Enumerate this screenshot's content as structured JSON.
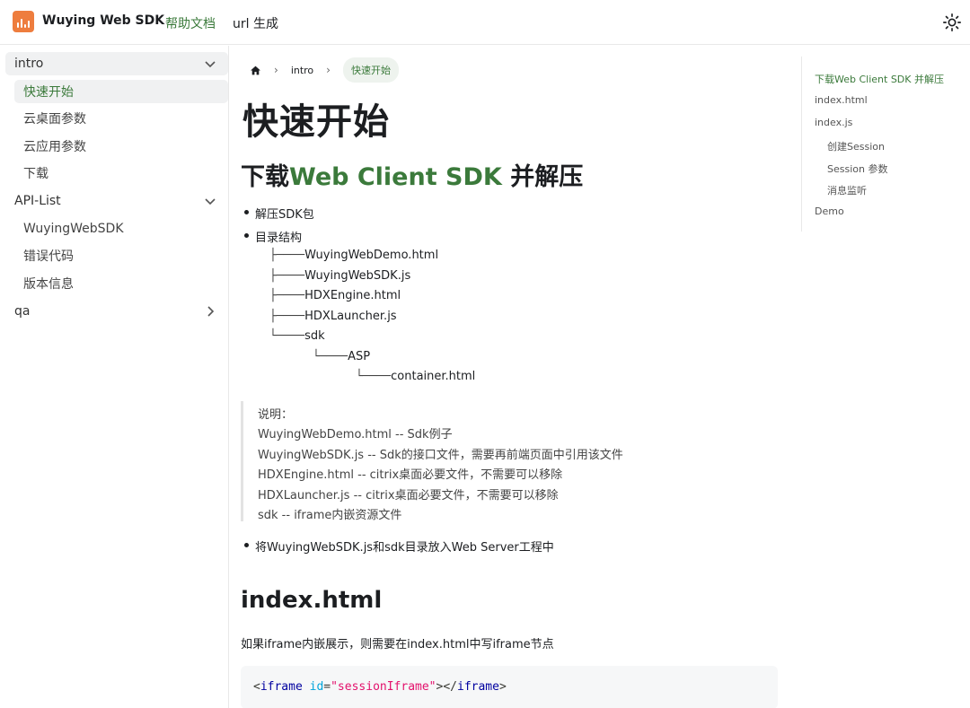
{
  "header": {
    "brand": "Wuying Web SDK",
    "nav": [
      {
        "label": "帮助文档",
        "active": true
      },
      {
        "label": "url 生成",
        "active": false
      }
    ],
    "theme_icon": "sun-icon"
  },
  "sidebar": {
    "categories": [
      {
        "label": "intro",
        "expanded": true,
        "items": [
          "快速开始",
          "云桌面参数",
          "云应用参数",
          "下载"
        ],
        "selected": "快速开始"
      },
      {
        "label": "API-List",
        "expanded": true,
        "items": [
          "WuyingWebSDK",
          "错误代码",
          "版本信息"
        ]
      },
      {
        "label": "qa",
        "expanded": false,
        "items": []
      }
    ]
  },
  "breadcrumbs": {
    "home_icon": "home-icon",
    "items": [
      "intro",
      "快速开始"
    ]
  },
  "page": {
    "title": "快速开始",
    "section1": {
      "title_prefix": "下载",
      "title_highlight": "Web Client SDK",
      "title_suffix": " 并解压",
      "bullets": [
        "解压SDK包",
        "目录结构"
      ],
      "tree": [
        {
          "glyph": "├────",
          "name": "WuyingWebDemo.html"
        },
        {
          "glyph": "├────",
          "name": "WuyingWebSDK.js"
        },
        {
          "glyph": "├────",
          "name": "HDXEngine.html"
        },
        {
          "glyph": "├────",
          "name": "HDXLauncher.js"
        },
        {
          "glyph": "└────",
          "name": "sdk"
        },
        {
          "glyph": "└────",
          "name": "ASP"
        },
        {
          "glyph": "└────",
          "name": "container.html"
        }
      ],
      "note": [
        "说明：",
        "WuyingWebDemo.html -- Sdk例子",
        "WuyingWebSDK.js -- Sdk的接口文件，需要再前端页面中引用该文件",
        "HDXEngine.html -- citrix桌面必要文件，不需要可以移除",
        "HDXLauncher.js -- citrix桌面必要文件，不需要可以移除",
        "sdk -- iframe内嵌资源文件"
      ],
      "bullet_after": "将WuyingWebSDK.js和sdk目录放入Web Server工程中"
    },
    "section2": {
      "title": "index.html",
      "paragraph": "如果iframe内嵌展示，则需要在index.html中写iframe节点",
      "code": {
        "open": "<",
        "tag": "iframe",
        "attr": "id",
        "eq": "=",
        "value": "\"sessionIframe\"",
        "close": "></",
        "tag2": "iframe",
        "end": ">"
      }
    }
  },
  "toc": [
    {
      "label": "下载Web Client SDK 并解压",
      "level": 1,
      "active": true
    },
    {
      "label": "index.html",
      "level": 1
    },
    {
      "label": "index.js",
      "level": 1
    },
    {
      "label": "创建Session",
      "level": 2
    },
    {
      "label": "Session 参数",
      "level": 2
    },
    {
      "label": "消息监听",
      "level": 2
    },
    {
      "label": "Demo",
      "level": 1
    }
  ],
  "colors": {
    "accent": "#3b7a3b",
    "logo": "#ee7d3e"
  }
}
